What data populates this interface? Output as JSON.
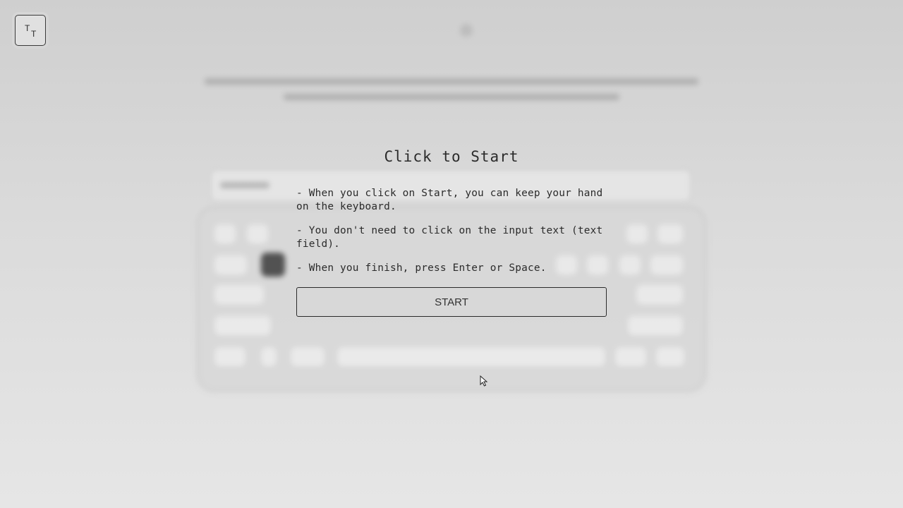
{
  "font_toggle": {
    "glyph_large": "T",
    "glyph_small": "T",
    "icon": "text-size-icon"
  },
  "start_dialog": {
    "title": "Click to Start",
    "instructions": [
      "- When you click on Start, you can keep your hand on the keyboard.",
      "- You don't need to click on the input text (text field).",
      "- When you finish, press Enter or Space."
    ],
    "start_button_label": "START"
  },
  "colors": {
    "text": "#2b2b2b",
    "background_top": "#cfcfcf",
    "background_bottom": "#e6e6e6"
  }
}
